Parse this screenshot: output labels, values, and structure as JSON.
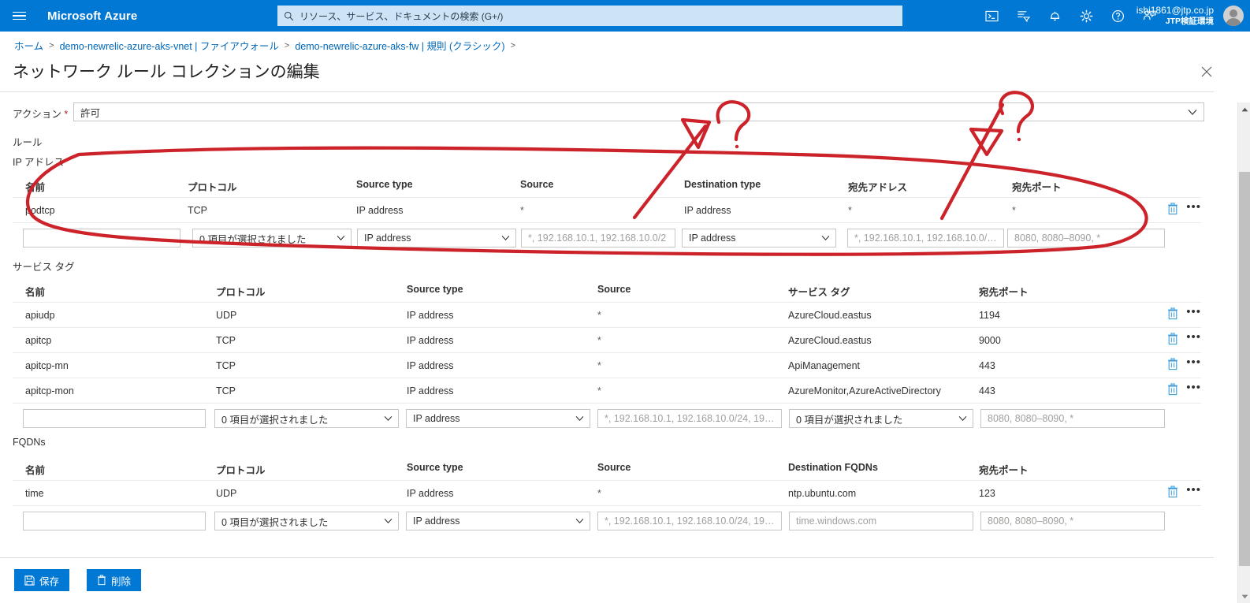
{
  "topbar": {
    "menu_icon": "hamburger-icon",
    "brand": "Microsoft Azure",
    "search_placeholder": "リソース、サービス、ドキュメントの検索 (G+/)",
    "search_icon": "search-icon",
    "icons": [
      "cloud-shell-icon",
      "directories-filter-icon",
      "notifications-bell-icon",
      "settings-gear-icon",
      "help-question-icon",
      "feedback-person-icon"
    ],
    "account_email": "ishi1861@jtp.co.jp",
    "account_tenant": "JTP検証環境",
    "avatar": "user-avatar"
  },
  "breadcrumb": {
    "items": [
      "ホーム",
      "demo-newrelic-azure-aks-vnet | ファイアウォール",
      "demo-newrelic-azure-aks-fw | 規則 (クラシック)"
    ],
    "separator": ">"
  },
  "page": {
    "title": "ネットワーク ルール コレクションの編集",
    "more_label": "...",
    "close_label": "×"
  },
  "action": {
    "label": "アクション",
    "required_marker": "*",
    "value": "許可"
  },
  "rules_label": "ルール",
  "ip_section": {
    "label": "IP アドレス",
    "columns": [
      "名前",
      "プロトコル",
      "Source type",
      "Source",
      "Destination type",
      "宛先アドレス",
      "宛先ポート"
    ],
    "rows": [
      {
        "name": "podtcp",
        "protocol": "TCP",
        "source_type": "IP address",
        "source": "*",
        "destination_type": "IP address",
        "destination_address": "*",
        "destination_port": "*"
      }
    ],
    "new_row": {
      "name_placeholder": "",
      "protocol_value": "0 項目が選択されました",
      "source_type_value": "IP address",
      "source_placeholder": "*, 192.168.10.1, 192.168.10.0/2",
      "destination_type_value": "IP address",
      "destination_address_placeholder": "*, 192.168.10.1, 192.168.10.0/2...",
      "destination_port_placeholder": "8080, 8080–8090, *"
    }
  },
  "service_tag_section": {
    "label": "サービス タグ",
    "columns": [
      "名前",
      "プロトコル",
      "Source type",
      "Source",
      "サービス タグ",
      "宛先ポート"
    ],
    "rows": [
      {
        "name": "apiudp",
        "protocol": "UDP",
        "source_type": "IP address",
        "source": "*",
        "service_tag": "AzureCloud.eastus",
        "destination_port": "1194"
      },
      {
        "name": "apitcp",
        "protocol": "TCP",
        "source_type": "IP address",
        "source": "*",
        "service_tag": "AzureCloud.eastus",
        "destination_port": "9000"
      },
      {
        "name": "apitcp-mn",
        "protocol": "TCP",
        "source_type": "IP address",
        "source": "*",
        "service_tag": "ApiManagement",
        "destination_port": "443"
      },
      {
        "name": "apitcp-mon",
        "protocol": "TCP",
        "source_type": "IP address",
        "source": "*",
        "service_tag": "AzureMonitor,AzureActiveDirectory",
        "destination_port": "443"
      }
    ],
    "new_row": {
      "name_placeholder": "",
      "protocol_value": "0 項目が選択されました",
      "source_type_value": "IP address",
      "source_placeholder": "*, 192.168.10.1, 192.168.10.0/24, 192....",
      "service_tag_value": "0 項目が選択されました",
      "destination_port_placeholder": "8080, 8080–8090, *"
    }
  },
  "fqdn_section": {
    "label": "FQDNs",
    "columns": [
      "名前",
      "プロトコル",
      "Source type",
      "Source",
      "Destination FQDNs",
      "宛先ポート"
    ],
    "rows": [
      {
        "name": "time",
        "protocol": "UDP",
        "source_type": "IP address",
        "source": "*",
        "destination_fqdns": "ntp.ubuntu.com",
        "destination_port": "123"
      }
    ],
    "new_row": {
      "name_placeholder": "",
      "protocol_value": "0 項目が選択されました",
      "source_type_value": "IP address",
      "source_placeholder": "*, 192.168.10.1, 192.168.10.0/24, 192....",
      "destination_fqdns_placeholder": "time.windows.com",
      "destination_port_placeholder": "8080, 8080–8090, *"
    }
  },
  "footer": {
    "save_label": "保存",
    "save_icon": "save-disk-icon",
    "delete_label": "削除",
    "delete_icon": "trash-icon"
  },
  "row_actions": {
    "delete_icon": "trash-icon",
    "more_icon": "ellipsis-icon"
  },
  "annotations": {
    "color": "#cc2229",
    "marks": [
      "arrow-to-destination-type",
      "question-mark-1",
      "arrow-to-destination-port",
      "question-mark-2",
      "ellipse-around-ip-rule-row"
    ]
  },
  "colors": {
    "azure_blue": "#0078d4",
    "link_blue": "#0067b8",
    "annotation_red": "#cc2229"
  }
}
